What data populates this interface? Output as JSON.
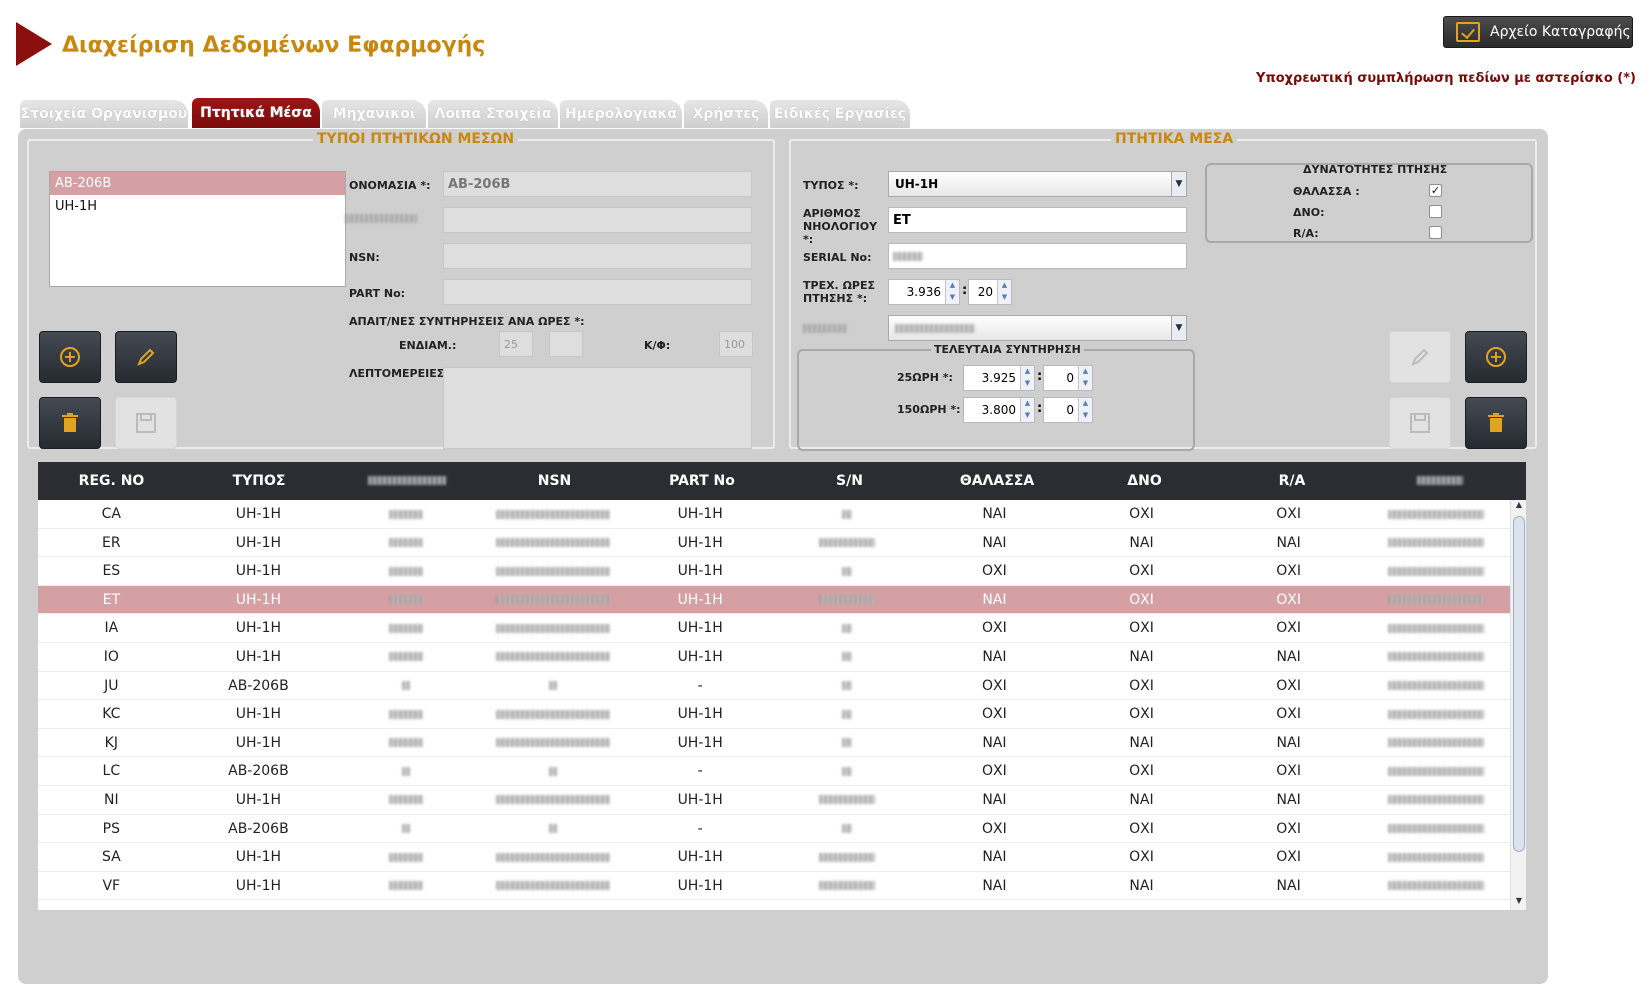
{
  "header": {
    "title": "Διαχείριση Δεδομένων Εφαρμογής",
    "log_button": "Αρχείο Καταγραφής",
    "required_note": "Υποχρεωτική συμπλήρωση πεδίων με αστερίσκο (*)"
  },
  "tabs": [
    "Στοιχεία Οργανισμού",
    "Πτητικά Μέσα",
    "Μηχανικοί",
    "Λοιπά Στοιχεία",
    "Ημερολογιακά",
    "Χρήστες",
    "Ειδικές Εργασίες"
  ],
  "types_panel": {
    "title": "ΤΥΠΟΙ ΠΤΗΤΙΚΩΝ ΜΕΣΩΝ",
    "list": [
      "AB-206B",
      "UH-1H"
    ],
    "labels": {
      "name": "ΟΝΟΜΑΣΙΑ *:",
      "nsn": "NSN:",
      "part": "PART No:",
      "maint_hours": "ΑΠΑΙΤ/ΝΕΣ ΣΥΝΤΗΡΗΣΕΙΣ ΑΝΑ ΩΡΕΣ *:",
      "intermediate": "ΕΝΔΙΑΜ.:",
      "kf": "Κ/Φ:",
      "details": "ΛΕΠΤΟΜΕΡΕΙΕΣ:"
    },
    "values": {
      "name": "AB-206B",
      "intermediate": "25",
      "kf": "100"
    }
  },
  "aircraft_panel": {
    "title": "ΠΤΗΤΙΚΑ ΜΕΣΑ",
    "labels": {
      "type": "ΤΥΠΟΣ *:",
      "registry": "ΑΡΙΘΜΟΣ ΝΗΟΛΟΓΙΟΥ *:",
      "serial": "SERIAL No:",
      "hours": "ΤΡΕΧ. ΩΡΕΣ ΠΤΗΣΗΣ *:",
      "last_maint": "ΤΕΛΕΥΤΑΙΑ ΣΥΝΤΗΡΗΣΗ",
      "h25": "25ΩΡΗ *:",
      "h150": "150ΩΡΗ *:",
      "capabilities": "ΔΥΝΑΤΟΤΗΤΕΣ ΠΤΗΣΗΣ",
      "sea": "ΘΑΛΑΣΣΑ :",
      "dno": "ΔΝΟ:",
      "ra": "R/A:"
    },
    "values": {
      "type": "UH-1H",
      "registry": "ET",
      "hours": "3.936",
      "minutes": "20",
      "h25_hours": "3.925",
      "h25_minutes": "0",
      "h150_hours": "3.800",
      "h150_minutes": "0",
      "sea_checked": true,
      "dno_checked": false,
      "ra_checked": false
    }
  },
  "table": {
    "columns": [
      "REG. NO",
      "ΤΥΠΟΣ",
      "",
      "NSN",
      "PART No",
      "S/N",
      "ΘΑΛΑΣΣΑ",
      "ΔΝΟ",
      "R/A",
      ""
    ],
    "rows": [
      [
        "CA",
        "UH-1H",
        "",
        "",
        "UH-1H",
        "",
        "ΝΑΙ",
        "ΟΧΙ",
        "ΟΧΙ",
        ""
      ],
      [
        "ER",
        "UH-1H",
        "",
        "",
        "UH-1H",
        "",
        "ΝΑΙ",
        "ΝΑΙ",
        "ΝΑΙ",
        ""
      ],
      [
        "ES",
        "UH-1H",
        "",
        "",
        "UH-1H",
        "",
        "ΟΧΙ",
        "ΟΧΙ",
        "ΟΧΙ",
        ""
      ],
      [
        "ET",
        "UH-1H",
        "",
        "",
        "UH-1H",
        "",
        "ΝΑΙ",
        "ΟΧΙ",
        "ΟΧΙ",
        ""
      ],
      [
        "IA",
        "UH-1H",
        "",
        "",
        "UH-1H",
        "",
        "ΟΧΙ",
        "ΟΧΙ",
        "ΟΧΙ",
        ""
      ],
      [
        "IO",
        "UH-1H",
        "",
        "",
        "UH-1H",
        "",
        "ΝΑΙ",
        "ΝΑΙ",
        "ΝΑΙ",
        ""
      ],
      [
        "JU",
        "AB-206B",
        "",
        "",
        "-",
        "",
        "ΟΧΙ",
        "ΟΧΙ",
        "ΟΧΙ",
        ""
      ],
      [
        "KC",
        "UH-1H",
        "",
        "",
        "UH-1H",
        "",
        "ΟΧΙ",
        "ΟΧΙ",
        "ΟΧΙ",
        ""
      ],
      [
        "KJ",
        "UH-1H",
        "",
        "",
        "UH-1H",
        "",
        "ΝΑΙ",
        "ΝΑΙ",
        "ΝΑΙ",
        ""
      ],
      [
        "LC",
        "AB-206B",
        "",
        "",
        "-",
        "",
        "ΟΧΙ",
        "ΟΧΙ",
        "ΟΧΙ",
        ""
      ],
      [
        "NI",
        "UH-1H",
        "",
        "",
        "UH-1H",
        "",
        "ΝΑΙ",
        "ΝΑΙ",
        "ΝΑΙ",
        ""
      ],
      [
        "PS",
        "AB-206B",
        "",
        "",
        "-",
        "",
        "ΟΧΙ",
        "ΟΧΙ",
        "ΟΧΙ",
        ""
      ],
      [
        "SA",
        "UH-1H",
        "",
        "",
        "UH-1H",
        "",
        "ΝΑΙ",
        "ΟΧΙ",
        "ΟΧΙ",
        ""
      ],
      [
        "VF",
        "UH-1H",
        "",
        "",
        "UH-1H",
        "",
        "ΝΑΙ",
        "ΝΑΙ",
        "ΝΑΙ",
        ""
      ]
    ],
    "selected_row": 3,
    "blurred_columns": [
      2,
      3,
      5,
      9
    ]
  },
  "colors": {
    "accent_gold": "#c8880f",
    "brand_red": "#8b0f0f",
    "selection": "#d4a0a4",
    "header_dark": "#2b2d33"
  }
}
